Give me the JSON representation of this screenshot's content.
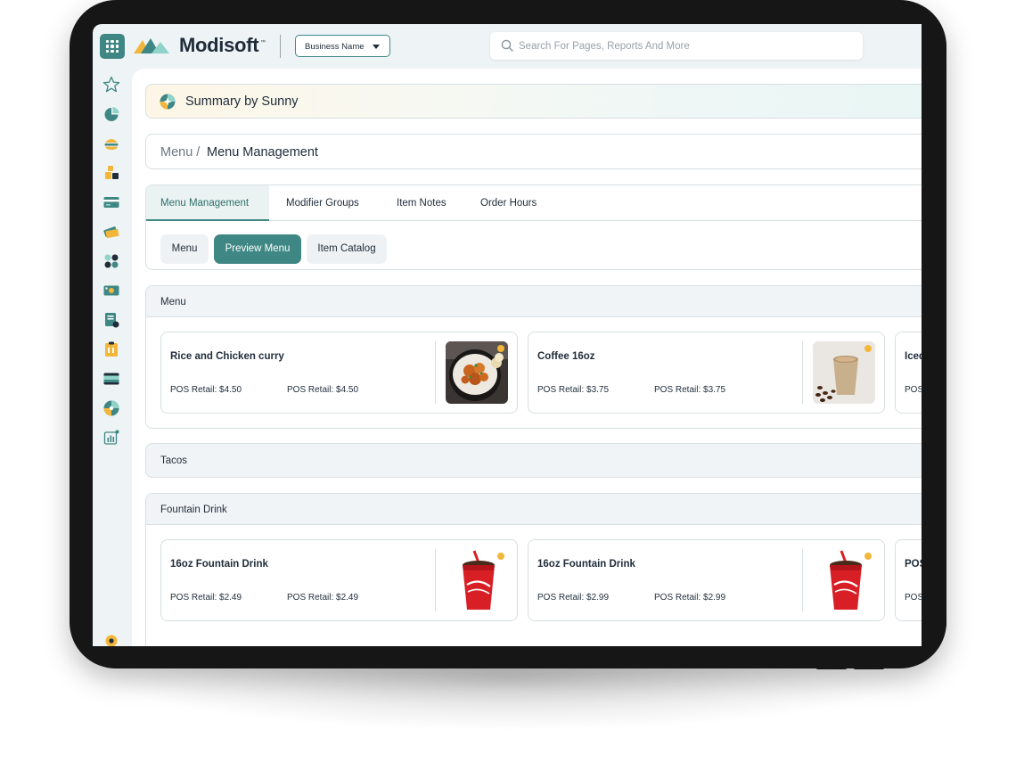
{
  "app": {
    "logo_text": "Modisoft",
    "logo_tm": "™",
    "business_select": "Business Name",
    "search_placeholder": "Search For Pages, Reports And More"
  },
  "sunny": {
    "label": "Summary by Sunny"
  },
  "breadcrumb": {
    "parent": "Menu /",
    "current": "Menu Management"
  },
  "tabs": [
    {
      "label": "Menu Management",
      "active": true
    },
    {
      "label": "Modifier Groups"
    },
    {
      "label": "Item Notes"
    },
    {
      "label": "Order Hours"
    }
  ],
  "pills": [
    {
      "label": "Menu"
    },
    {
      "label": "Preview Menu",
      "active": true
    },
    {
      "label": "Item Catalog"
    }
  ],
  "sections": {
    "menu": {
      "title": "Menu",
      "items": [
        {
          "name": "Rice and Chicken curry",
          "price_a": "POS Retail: $4.50",
          "price_b": "POS Retail: $4.50",
          "image": "curry-bowl"
        },
        {
          "name": "Coffee 16oz",
          "price_a": "POS Retail: $3.75",
          "price_b": "POS Retail: $3.75",
          "image": "coffee-cup"
        },
        {
          "name": "Iced",
          "price_a": "POS",
          "price_b": "",
          "image": ""
        }
      ]
    },
    "tacos": {
      "title": "Tacos"
    },
    "fountain": {
      "title": "Fountain Drink",
      "items": [
        {
          "name": "16oz Fountain Drink",
          "price_a": "POS Retail: $2.49",
          "price_b": "POS Retail: $2.49",
          "image": "soda-cup"
        },
        {
          "name": "16oz Fountain Drink",
          "price_a": "POS Retail: $2.99",
          "price_b": "POS Retail: $2.99",
          "image": "soda-cup"
        },
        {
          "name": "POS",
          "price_a": "POS",
          "price_b": "",
          "image": ""
        }
      ]
    }
  },
  "colors": {
    "accent": "#3f8784",
    "status_dot": "#f2b63a",
    "text": "#1f2c3a"
  },
  "rail_icons": [
    "star-icon",
    "pie-chart-icon",
    "burger-icon",
    "boxes-icon",
    "card-icon",
    "payments-icon",
    "apps-icon",
    "cash-icon",
    "report-icon",
    "clipboard-icon",
    "wallet-icon",
    "sunny-icon",
    "analytics-icon",
    "settings-icon"
  ]
}
